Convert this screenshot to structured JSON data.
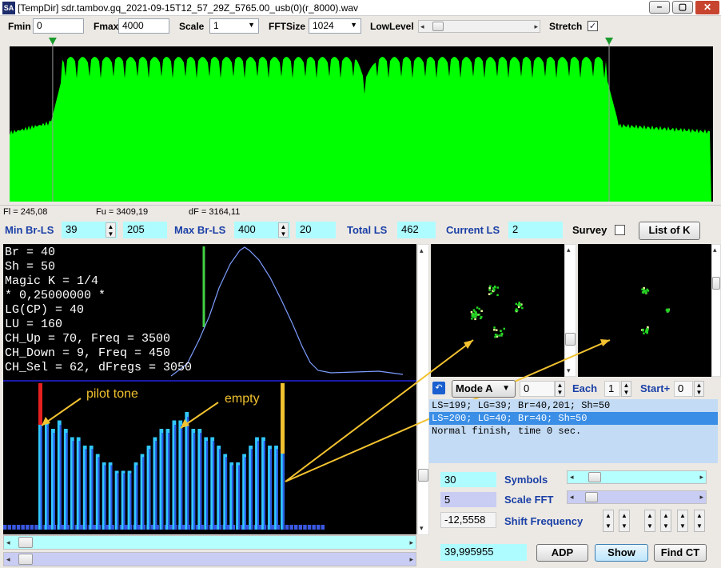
{
  "titlebar": {
    "icon_text": "SA",
    "title": "[TempDir] sdr.tambov.gq_2021-09-15T12_57_29Z_5765.00_usb(0)(r_8000).wav"
  },
  "toolbar": {
    "fmin_label": "Fmin",
    "fmin_value": "0",
    "fmax_label": "Fmax",
    "fmax_value": "4000",
    "scale_label": "Scale",
    "scale_value": "1",
    "fftsize_label": "FFTSize",
    "fftsize_value": "1024",
    "lowlevel_label": "LowLevel",
    "stretch_label": "Stretch",
    "stretch_checked": true
  },
  "spectrum": {
    "fl_text": "Fl = 245,08",
    "fu_text": "Fu = 3409,19",
    "df_text": "dF = 3164,11",
    "marker_left_hz": 245.08,
    "marker_right_hz": 3409.19,
    "f_max_hz": 4000,
    "color": "#00ff00"
  },
  "controls": {
    "min_br_ls_label": "Min Br-LS",
    "min_br_ls_value": "39",
    "min_br_ls_value2": "205",
    "max_br_ls_label": "Max Br-LS",
    "max_br_ls_value": "400",
    "max_br_ls_value2": "20",
    "total_ls_label": "Total LS",
    "total_ls_value": "462",
    "current_ls_label": "Current LS",
    "current_ls_value": "2",
    "survey_label": "Survey",
    "list_of_k_label": "List of K"
  },
  "info_lines": [
    "Br = 40",
    "Sh = 50",
    "Magic K = 1/4",
    "* 0,25000000 *",
    "LG(CP) = 40",
    "LU = 160",
    "CH_Up = 70, Freq = 3500",
    "CH_Down = 9, Freq = 450",
    "CH_Sel = 62, dFregs = 3050"
  ],
  "annotations": {
    "pilot": "pilot tone",
    "empty": "empty"
  },
  "mode": {
    "mode_label": "Mode A",
    "mode_value": "0",
    "each_label": "Each",
    "each_value": "1",
    "start_label": "Start+",
    "start_value": "0"
  },
  "log_lines": [
    "LS=199; LG=39; Br=40,201; Sh=50",
    "LS=200; LG=40; Br=40; Sh=50",
    "Normal finish, time 0 sec."
  ],
  "params": {
    "symbols_value": "30",
    "symbols_label": "Symbols",
    "scalefft_value": "5",
    "scalefft_label": "Scale FFT",
    "shift_value": "-12,5558",
    "shift_label": "Shift Frequency",
    "freq_value": "39,995955",
    "adp_label": "ADP",
    "show_label": "Show",
    "findct_label": "Find CT"
  },
  "bars": {
    "values": [
      14,
      13,
      12,
      13,
      12,
      11,
      11,
      10,
      10,
      9,
      8,
      8,
      7,
      7,
      7,
      8,
      9,
      10,
      11,
      12,
      12,
      13,
      13,
      14,
      12,
      12,
      11,
      11,
      10,
      9,
      8,
      8,
      9,
      10,
      11,
      11,
      10,
      10,
      14
    ]
  }
}
